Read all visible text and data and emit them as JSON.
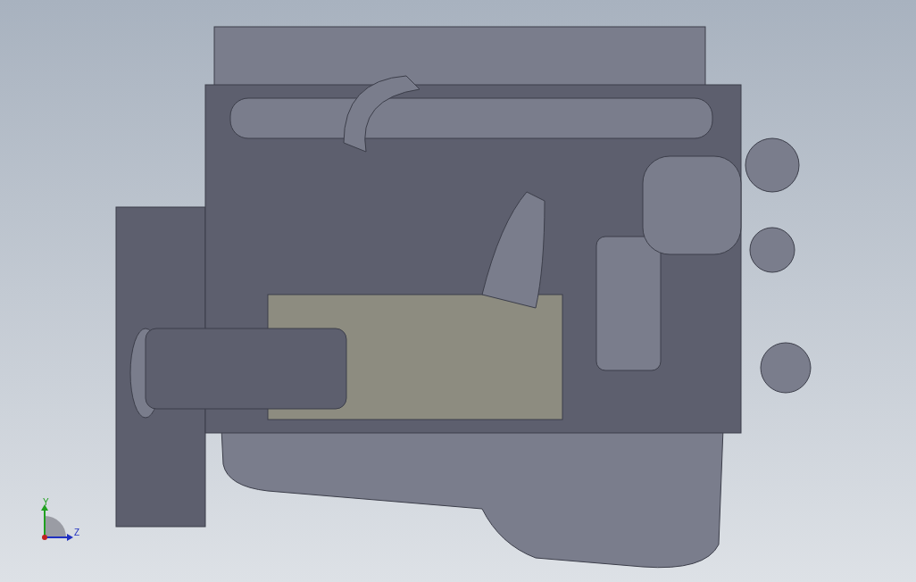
{
  "viewport": {
    "model": {
      "kind": "engine"
    },
    "triad": {
      "y_label": "Y",
      "z_label": "Z"
    }
  }
}
